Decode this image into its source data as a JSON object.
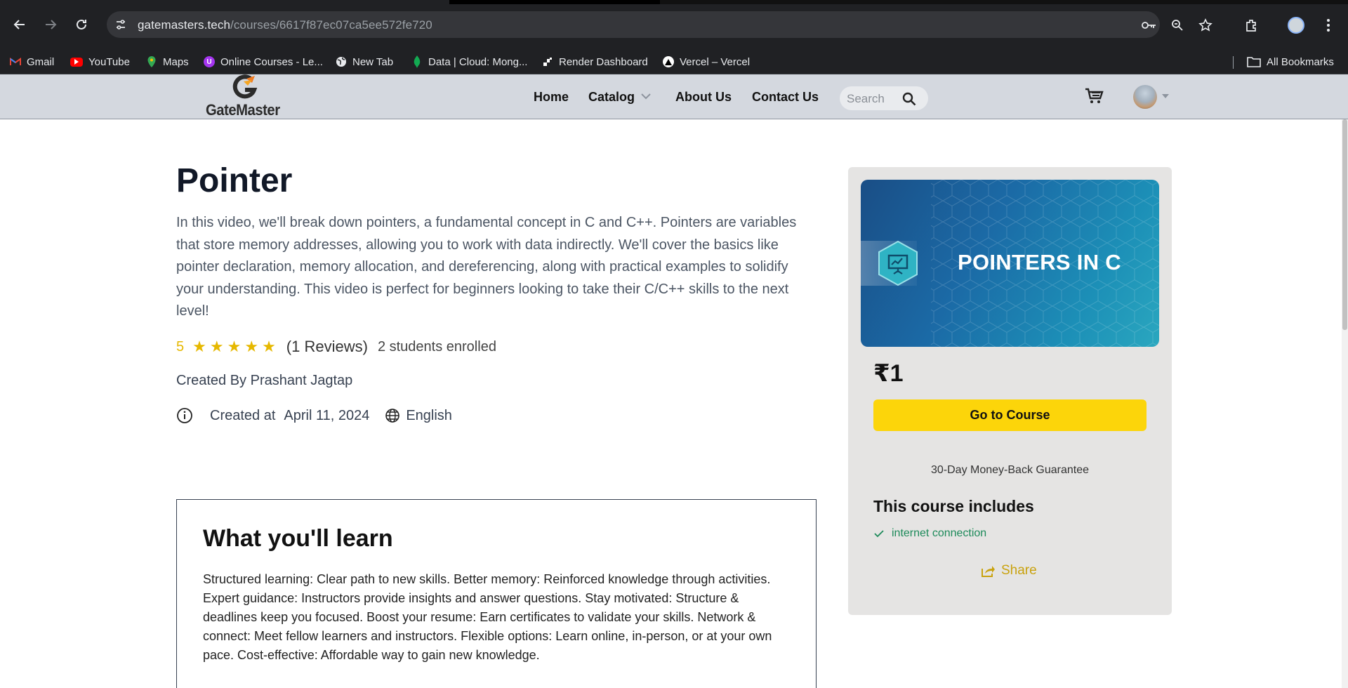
{
  "browser": {
    "url_host": "gatemasters.tech",
    "url_path": "/courses/6617f87ec07ca5ee572fe720",
    "bookmarks": [
      {
        "label": "Gmail",
        "icon": "gmail-icon",
        "color": "#ea4335"
      },
      {
        "label": "YouTube",
        "icon": "youtube-icon",
        "color": "#ff0000"
      },
      {
        "label": "Maps",
        "icon": "maps-icon",
        "color": "#34a853"
      },
      {
        "label": "Online Courses - Le...",
        "icon": "udemy-icon",
        "color": "#a435f0"
      },
      {
        "label": "New Tab",
        "icon": "globe-icon",
        "color": "#e8eaed"
      },
      {
        "label": "Data | Cloud: Mong...",
        "icon": "mongodb-icon",
        "color": "#13aa52"
      },
      {
        "label": "Render Dashboard",
        "icon": "render-icon",
        "color": "#ffffff"
      },
      {
        "label": "Vercel – Vercel",
        "icon": "vercel-icon",
        "color": "#ffffff"
      }
    ],
    "all_bookmarks_label": "All Bookmarks"
  },
  "header": {
    "logo_text": "GateMaster",
    "nav": {
      "home": "Home",
      "catalog": "Catalog",
      "about": "About Us",
      "contact": "Contact Us"
    },
    "search_placeholder": "Search"
  },
  "course": {
    "title": "Pointer",
    "description": "In this video, we'll break down pointers, a fundamental concept in C and C++. Pointers are variables that store memory addresses, allowing you to work with data indirectly. We'll cover the basics like pointer declaration, memory allocation, and dereferencing, along with practical examples to solidify your understanding. This video is perfect for beginners looking to take their C/C++ skills to the next level!",
    "rating": "5",
    "stars": 5,
    "reviews": "(1 Reviews)",
    "enrolled": "2 students enrolled",
    "created_by": "Created By Prashant Jagtap",
    "created_at_label": "Created at",
    "created_at": "April 11, 2024",
    "language": "English"
  },
  "learn": {
    "heading": "What you'll learn",
    "text": "Structured learning: Clear path to new skills. Better memory: Reinforced knowledge through activities. Expert guidance: Instructors provide insights and answer questions. Stay motivated: Structure & deadlines keep you focused. Boost your resume: Earn certificates to validate your skills. Network & connect: Meet fellow learners and instructors. Flexible options: Learn online, in-person, or at your own pace. Cost-effective: Affordable way to gain new knowledge."
  },
  "card": {
    "thumbnail_text": "POINTERS IN C",
    "price": "₹1",
    "go_button": "Go to Course",
    "guarantee": "30-Day Money-Back Guarantee",
    "includes_heading": "This course includes",
    "includes": [
      "internet connection"
    ],
    "share": "Share"
  },
  "colors": {
    "accent_yellow": "#fcd50a",
    "star": "#e6b800",
    "include_green": "#1d8a5a",
    "share_gold": "#c9a20e"
  }
}
